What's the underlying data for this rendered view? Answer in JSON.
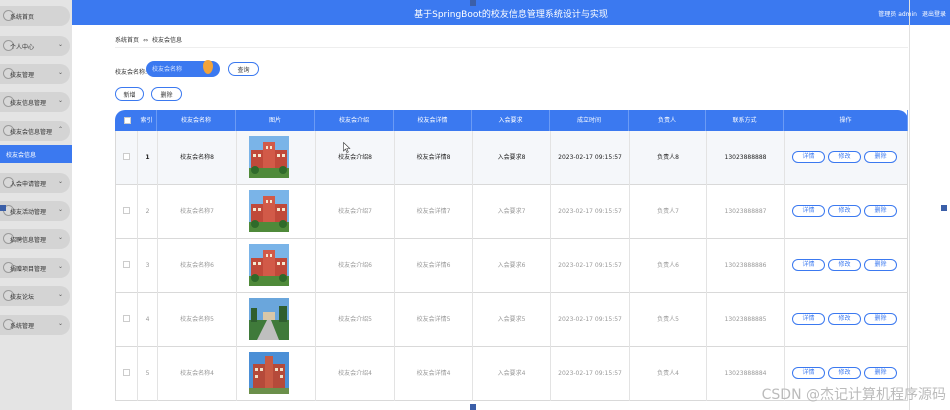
{
  "header": {
    "title": "基于SpringBoot的校友信息管理系统设计与实现",
    "user_label": "管理员 admin",
    "logout_label": "退出登录"
  },
  "sidebar": {
    "items": [
      {
        "label": "系统首页",
        "chevron": false
      },
      {
        "label": "个人中心",
        "chevron": true
      },
      {
        "label": "校友管理",
        "chevron": true
      },
      {
        "label": "校友信息管理",
        "chevron": true
      },
      {
        "label": "校友会信息管理",
        "chevron": "up"
      },
      {
        "label": "入会申请管理",
        "chevron": true
      },
      {
        "label": "校友活动管理",
        "chevron": true
      },
      {
        "label": "招聘信息管理",
        "chevron": true
      },
      {
        "label": "捐赠项目管理",
        "chevron": true
      },
      {
        "label": "校友论坛",
        "chevron": true
      },
      {
        "label": "系统管理",
        "chevron": true
      }
    ],
    "active_sub": "校友会信息"
  },
  "breadcrumb": {
    "home": "系统首页",
    "separator": "⇔",
    "current": "校友会信息"
  },
  "search": {
    "label": "校友会名称:",
    "placeholder": "校友会名称",
    "query_label": "查询"
  },
  "actions": {
    "add_label": "新增",
    "delete_label": "删除"
  },
  "table": {
    "columns": [
      "索引",
      "校友会名称",
      "图片",
      "校友会介绍",
      "校友会详情",
      "入会要求",
      "成立时间",
      "负责人",
      "联系方式",
      "操作"
    ],
    "row_buttons": {
      "detail": "详情",
      "edit": "修改",
      "delete": "删除"
    },
    "rows": [
      {
        "index": "1",
        "name": "校友会名称8",
        "intro": "校友会介绍8",
        "detail": "校友会详情8",
        "req": "入会要求8",
        "time": "2023-02-17 09:15:57",
        "leader": "负责人8",
        "phone": "13023888888",
        "img": "campus-red"
      },
      {
        "index": "2",
        "name": "校友会名称7",
        "intro": "校友会介绍7",
        "detail": "校友会详情7",
        "req": "入会要求7",
        "time": "2023-02-17 09:15:57",
        "leader": "负责人7",
        "phone": "13023888887",
        "img": "campus-red"
      },
      {
        "index": "3",
        "name": "校友会名称6",
        "intro": "校友会介绍6",
        "detail": "校友会详情6",
        "req": "入会要求6",
        "time": "2023-02-17 09:15:57",
        "leader": "负责人6",
        "phone": "13023888886",
        "img": "campus-red"
      },
      {
        "index": "4",
        "name": "校友会名称5",
        "intro": "校友会介绍5",
        "detail": "校友会详情5",
        "req": "入会要求5",
        "time": "2023-02-17 09:15:57",
        "leader": "负责人5",
        "phone": "13023888885",
        "img": "campus-road"
      },
      {
        "index": "5",
        "name": "校友会名称4",
        "intro": "校友会介绍4",
        "detail": "校友会详情4",
        "req": "入会要求4",
        "time": "2023-02-17 09:15:57",
        "leader": "负责人4",
        "phone": "13023888884",
        "img": "campus-tower"
      }
    ]
  },
  "watermark": "CSDN @杰记计算机程序源码",
  "colors": {
    "primary": "#3b79f0",
    "sidebar": "#e4e4e4",
    "accent_orange": "#f2a33a"
  }
}
